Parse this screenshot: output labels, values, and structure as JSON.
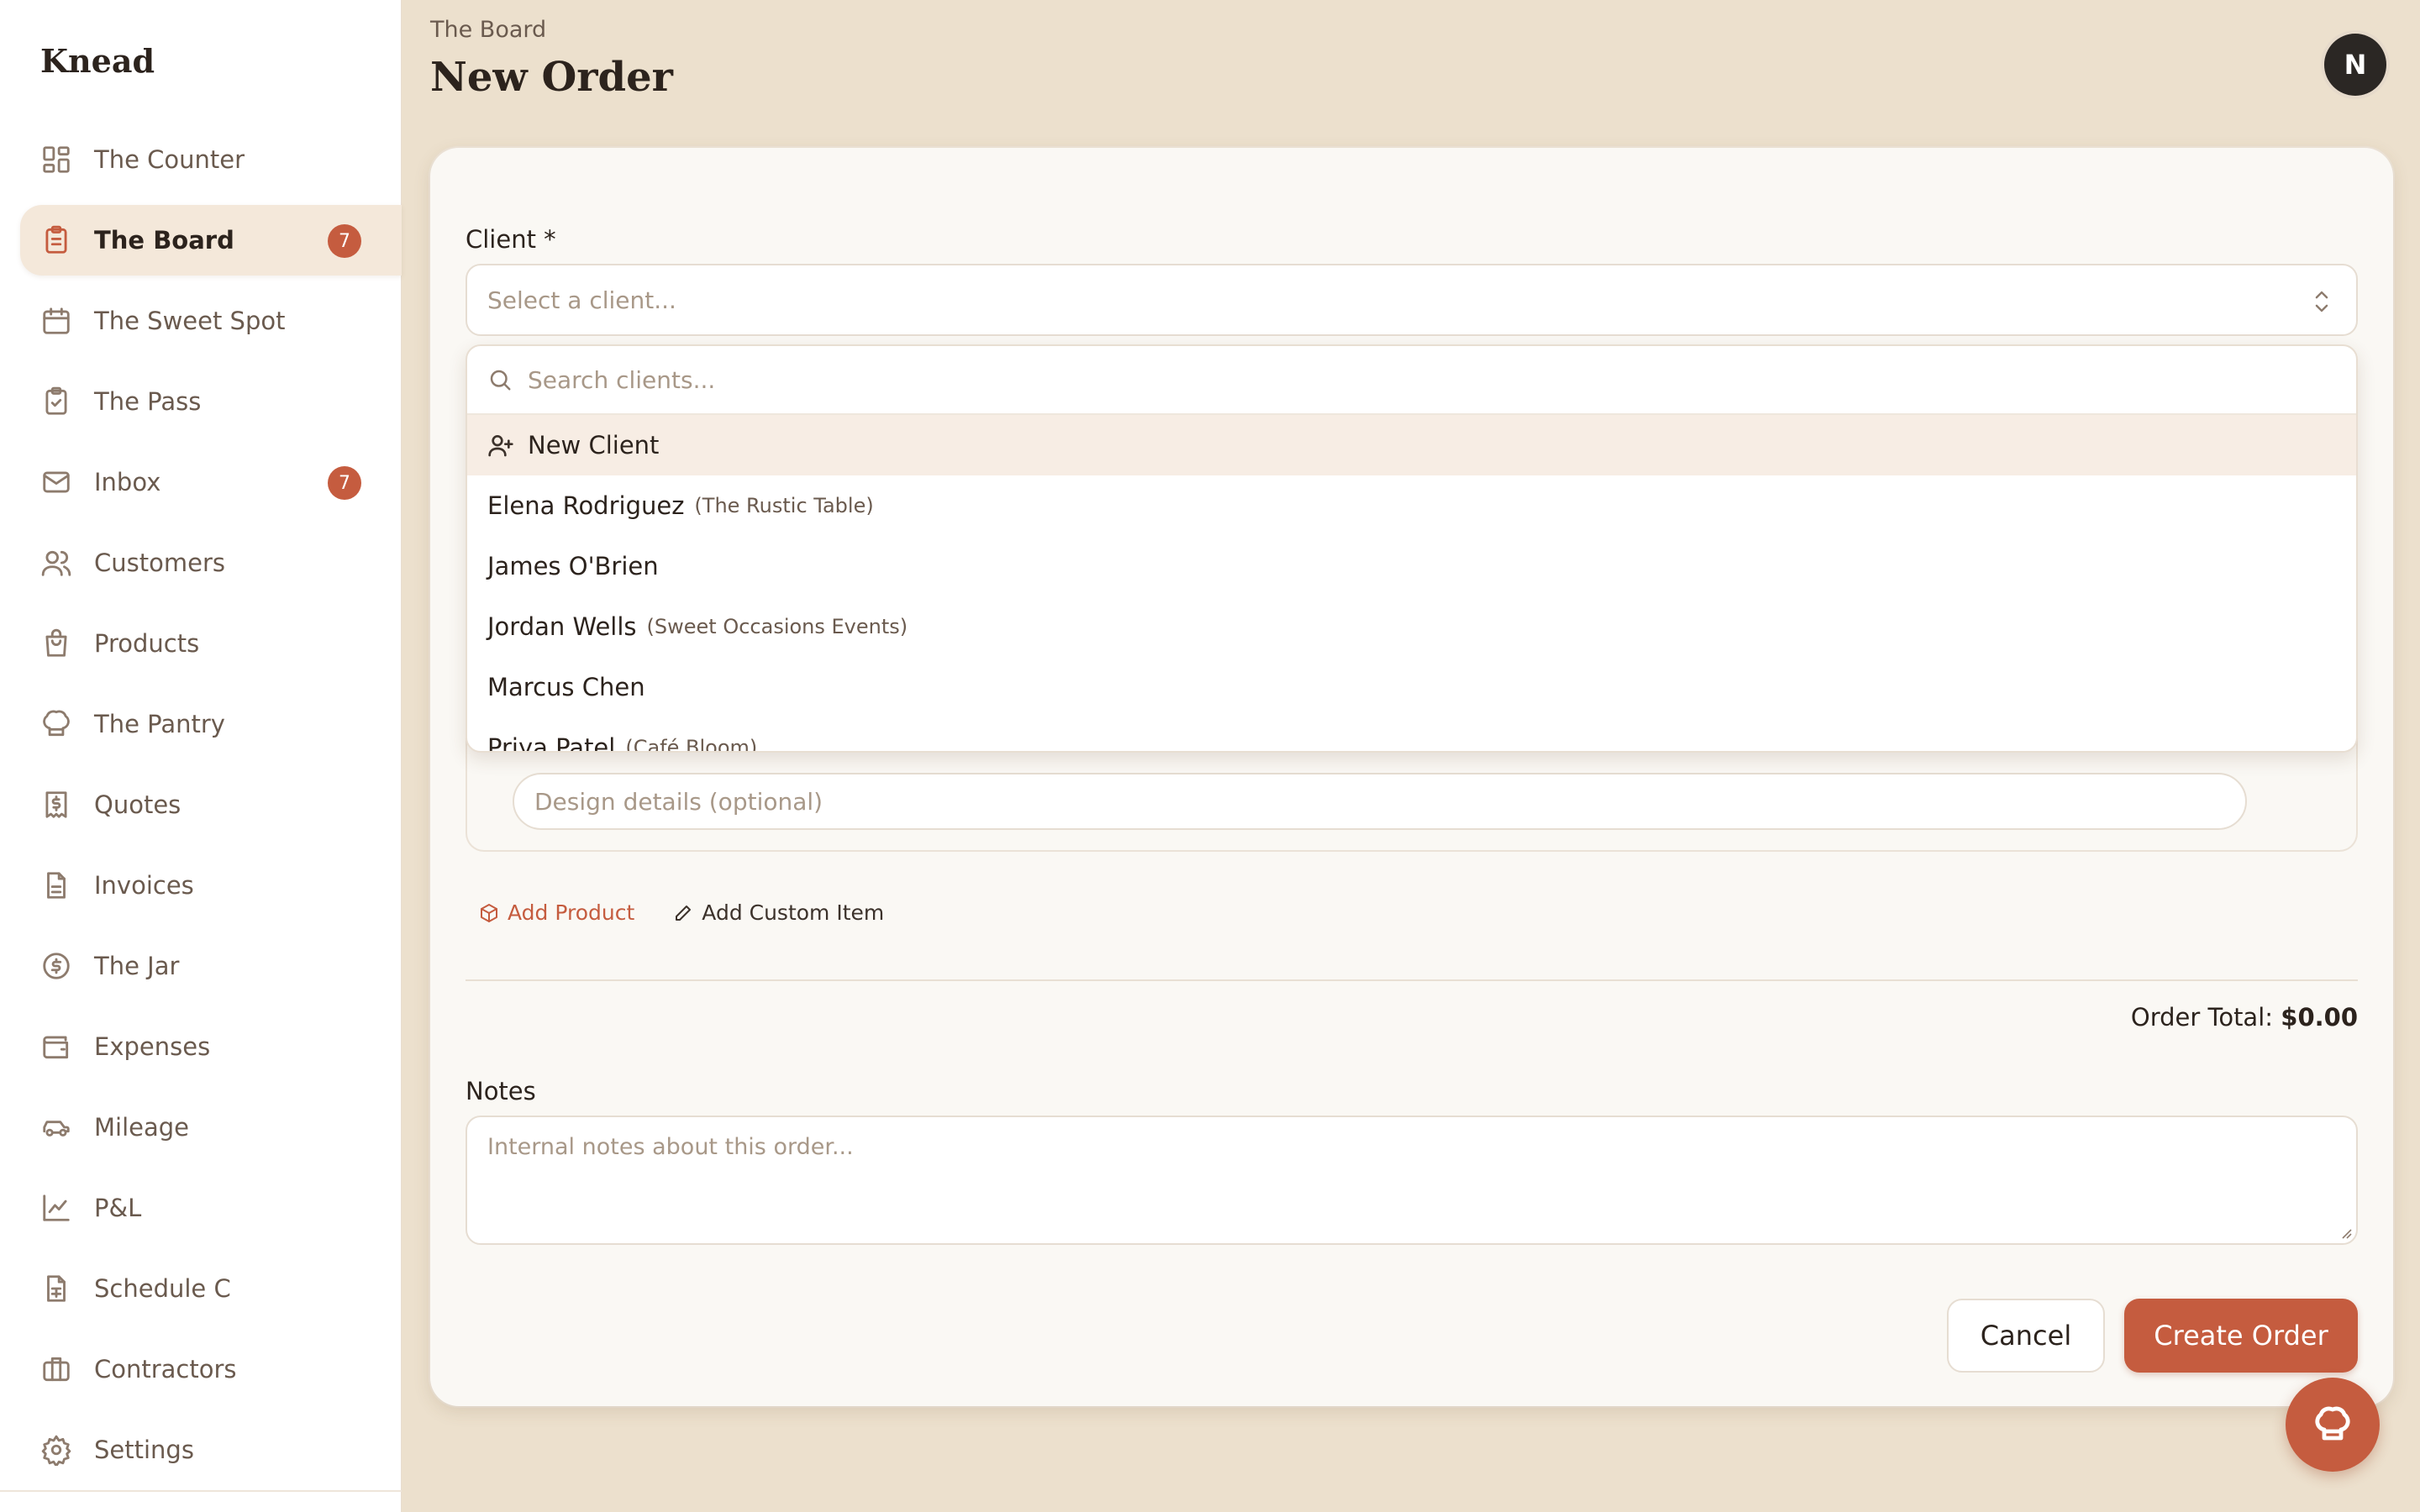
{
  "app": {
    "brand": "Knead"
  },
  "sidebar": {
    "items": [
      {
        "label": "The Counter",
        "icon": "dashboard-grid-icon"
      },
      {
        "label": "The Board",
        "icon": "clipboard-list-icon",
        "badge": "7",
        "active": true
      },
      {
        "label": "The Sweet Spot",
        "icon": "calendar-icon"
      },
      {
        "label": "The Pass",
        "icon": "clipboard-check-icon"
      },
      {
        "label": "Inbox",
        "icon": "mail-icon",
        "badge": "7"
      },
      {
        "label": "Customers",
        "icon": "users-icon"
      },
      {
        "label": "Products",
        "icon": "shopping-bag-icon"
      },
      {
        "label": "The Pantry",
        "icon": "chef-hat-icon"
      },
      {
        "label": "Quotes",
        "icon": "receipt-dollar-icon"
      },
      {
        "label": "Invoices",
        "icon": "file-text-icon"
      },
      {
        "label": "The Jar",
        "icon": "dollar-circle-icon"
      },
      {
        "label": "Expenses",
        "icon": "wallet-icon"
      },
      {
        "label": "Mileage",
        "icon": "car-icon"
      },
      {
        "label": "P&L",
        "icon": "line-chart-icon"
      },
      {
        "label": "Schedule C",
        "icon": "file-spreadsheet-icon"
      },
      {
        "label": "Contractors",
        "icon": "briefcase-icon"
      },
      {
        "label": "Settings",
        "icon": "gear-icon"
      }
    ]
  },
  "header": {
    "breadcrumb": "The Board",
    "title": "New Order",
    "avatar_initial": "N"
  },
  "form": {
    "client_label": "Client *",
    "client_placeholder": "Select a client...",
    "design_placeholder": "Design details (optional)",
    "add_product_label": "Add Product",
    "add_custom_label": "Add Custom Item",
    "order_total_label": "Order Total:",
    "order_total_value": "$0.00",
    "notes_label": "Notes",
    "notes_placeholder": "Internal notes about this order...",
    "cancel_label": "Cancel",
    "create_label": "Create Order"
  },
  "dropdown": {
    "search_placeholder": "Search clients...",
    "new_client_label": "New Client",
    "clients": [
      {
        "name": "Elena Rodriguez",
        "company": "(The Rustic Table)"
      },
      {
        "name": "James O'Brien",
        "company": ""
      },
      {
        "name": "Jordan Wells",
        "company": "(Sweet Occasions Events)"
      },
      {
        "name": "Marcus Chen",
        "company": ""
      },
      {
        "name": "Priya Patel",
        "company": "(Café Bloom)"
      }
    ]
  },
  "colors": {
    "accent": "#c55c3f",
    "background": "#ece0cd",
    "card": "#faf8f4"
  }
}
